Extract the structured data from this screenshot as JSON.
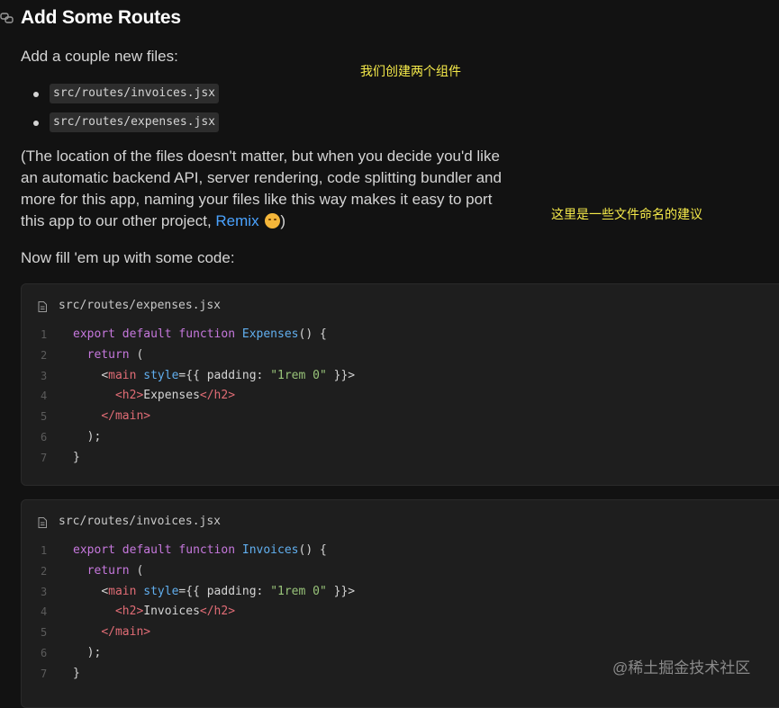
{
  "header": {
    "title": "Add Some Routes",
    "icon": "link-icon"
  },
  "intro": "Add a couple new files:",
  "annotation_top": "我们创建两个组件",
  "files": [
    {
      "name": "src/routes/invoices.jsx"
    },
    {
      "name": "src/routes/expenses.jsx"
    }
  ],
  "paragraph": {
    "lines": [
      "(The location of the files doesn't matter, but when you decide you'd like",
      "an automatic backend API, server rendering, code splitting bundler and",
      "more for this app, naming your files like this way makes it easy to port"
    ],
    "last_line_prefix": "this app to our other project, ",
    "link": "Remix",
    "emoji": "smiling-face-emoji",
    "last_line_suffix": ")"
  },
  "annotation_right": "这里是一些文件命名的建议",
  "fill_text": "Now fill 'em up with some code:",
  "code_blocks": [
    {
      "filename": "src/routes/expenses.jsx",
      "line_numbers": [
        "1",
        "2",
        "3",
        "4",
        "5",
        "6",
        "7"
      ],
      "code": {
        "export": "export",
        "default": "default",
        "function": "function",
        "name": "Expenses",
        "sig_rest": "() {",
        "return": "return",
        "paren_open": "(",
        "lt": "<",
        "main": "main",
        "style": "style",
        "eq_braces": "={{ ",
        "padding": "padding: ",
        "value": "\"1rem 0\"",
        "close_braces": " }}>",
        "h2_open": "<h2>",
        "h2_text": "Expenses",
        "h2_close": "</h2>",
        "main_close": "</main>",
        "paren_close": ");",
        "brace_close": "}"
      }
    },
    {
      "filename": "src/routes/invoices.jsx",
      "line_numbers": [
        "1",
        "2",
        "3",
        "4",
        "5",
        "6",
        "7"
      ],
      "code": {
        "export": "export",
        "default": "default",
        "function": "function",
        "name": "Invoices",
        "sig_rest": "() {",
        "return": "return",
        "paren_open": "(",
        "lt": "<",
        "main": "main",
        "style": "style",
        "eq_braces": "={{ ",
        "padding": "padding: ",
        "value": "\"1rem 0\"",
        "close_braces": " }}>",
        "h2_open": "<h2>",
        "h2_text": "Invoices",
        "h2_close": "</h2>",
        "main_close": "</main>",
        "paren_close": ");",
        "brace_close": "}"
      }
    }
  ],
  "watermark": "@稀土掘金技术社区",
  "colors": {
    "background": "#121212",
    "code_background": "#1e1e1e",
    "keyword": "#c678dd",
    "function": "#61afef",
    "tag": "#e06c75",
    "string": "#98c379",
    "link": "#4aa3ff",
    "annotation": "#f5ea4a"
  }
}
